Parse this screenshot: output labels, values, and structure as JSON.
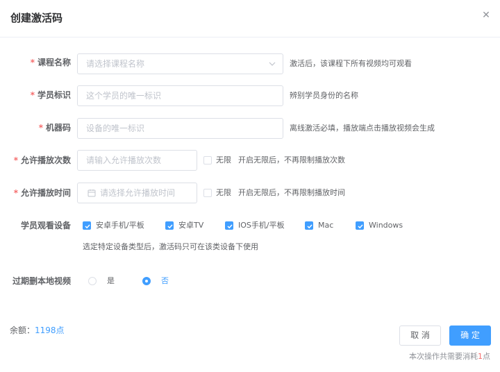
{
  "dialog": {
    "title": "创建激活码",
    "close_glyph": "✕"
  },
  "form": {
    "course": {
      "label": "课程名称",
      "placeholder": "请选择课程名称",
      "hint": "激活后，该课程下所有视频均可观看"
    },
    "student": {
      "label": "学员标识",
      "placeholder": "这个学员的唯一标识",
      "hint": "辨别学员身份的名称"
    },
    "machine": {
      "label": "机器码",
      "placeholder": "设备的唯一标识",
      "hint": "离线激活必填，播放端点击播放视频会生成"
    },
    "play_count": {
      "label": "允许播放次数",
      "placeholder": "请输入允许播放次数",
      "unlimited_label": "无限",
      "hint": "开启无限后，不再限制播放次数"
    },
    "play_time": {
      "label": "允许播放时间",
      "placeholder": "请选择允许播放时间",
      "unlimited_label": "无限",
      "hint": "开启无限后，不再限制播放时间"
    },
    "devices": {
      "label": "学员观看设备",
      "options": [
        "安卓手机/平板",
        "安卓TV",
        "IOS手机/平板",
        "Mac",
        "Windows"
      ],
      "hint": "选定特定设备类型后，激活码只可在该类设备下使用"
    },
    "delete_local": {
      "label": "过期删本地视频",
      "options": [
        "是",
        "否"
      ],
      "selected": "否"
    },
    "required_mark": "*"
  },
  "footer": {
    "balance_label": "余额：",
    "balance_value": "1198点",
    "cancel_label": "取 消",
    "confirm_label": "确 定",
    "cost_prefix": "本次操作共需要消耗",
    "cost_number": "1",
    "cost_suffix": "点"
  },
  "colors": {
    "primary": "#409eff",
    "required": "#f56c6c"
  }
}
